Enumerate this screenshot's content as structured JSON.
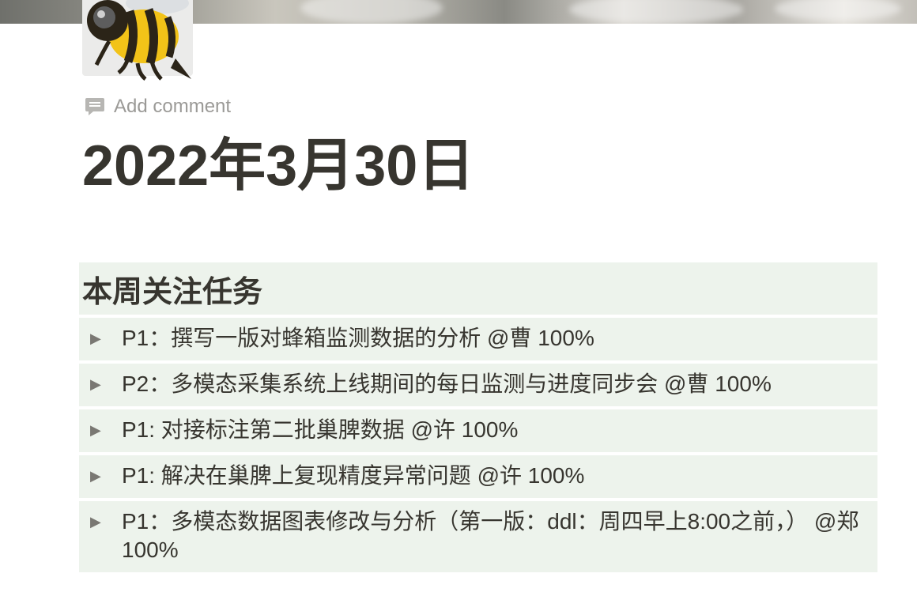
{
  "page": {
    "icon": "bee-icon",
    "add_comment": "Add comment",
    "title": "2022年3月30日"
  },
  "section": {
    "heading": "本周关注任务",
    "tasks": [
      {
        "text": "P1：撰写一版对蜂箱监测数据的分析 @曹 100%"
      },
      {
        "text": "P2：多模态采集系统上线期间的每日监测与进度同步会 @曹 100%"
      },
      {
        "text": "P1: 对接标注第二批巢脾数据 @许 100%"
      },
      {
        "text": "P1: 解决在巢脾上复现精度异常问题 @许 100%"
      },
      {
        "text": "P1：多模态数据图表修改与分析（第一版：ddl：周四早上8:00之前，） @郑  100%"
      }
    ]
  },
  "colors": {
    "callout_bg": "#edf3ec",
    "text": "#37352f",
    "muted": "#9b9a97"
  }
}
